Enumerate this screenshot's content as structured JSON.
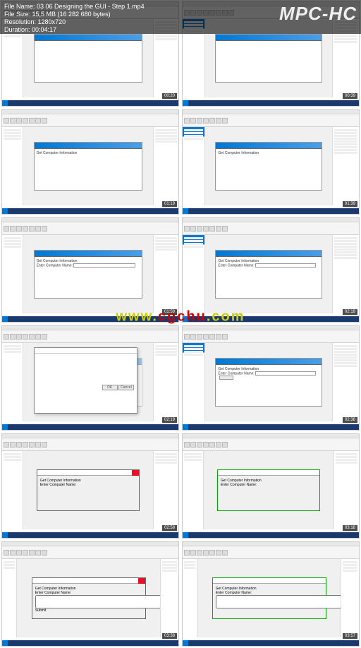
{
  "player": {
    "name": "MPC-HC",
    "file_name_label": "File Name:",
    "file_name": "03 06 Designing the GUI - Step 1.mp4",
    "file_size_label": "File Size:",
    "file_size": "15,5 MB (16 282 680 bytes)",
    "resolution_label": "Resolution:",
    "resolution": "1280x720",
    "duration_label": "Duration:",
    "duration": "00:04:17"
  },
  "watermark": "www.cgchu.com",
  "ide": {
    "form_title": "Get Computer Information",
    "label_text": "Enter Computer Name:",
    "button_text": "Submit",
    "run_title": "Get Computer Information",
    "dialog_ok": "OK",
    "dialog_cancel": "Cancel"
  },
  "thumbnails": [
    {
      "ts": "00:20",
      "kind": "design_empty"
    },
    {
      "ts": "00:39",
      "kind": "design_empty_sel"
    },
    {
      "ts": "01:19",
      "kind": "design_label"
    },
    {
      "ts": "01:39",
      "kind": "design_label_props"
    },
    {
      "ts": "01:59",
      "kind": "design_textbox"
    },
    {
      "ts": "02:19",
      "kind": "design_textbox"
    },
    {
      "ts": "02:19",
      "kind": "dialog"
    },
    {
      "ts": "02:38",
      "kind": "design_button"
    },
    {
      "ts": "02:58",
      "kind": "run"
    },
    {
      "ts": "03:18",
      "kind": "run"
    },
    {
      "ts": "03:38",
      "kind": "run_input"
    },
    {
      "ts": "03:57",
      "kind": "run_input"
    }
  ]
}
